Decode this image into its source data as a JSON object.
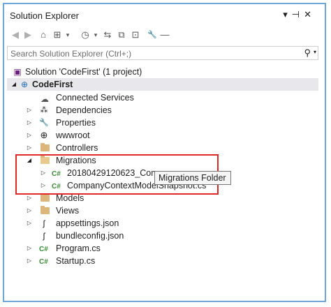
{
  "window": {
    "title": "Solution Explorer",
    "controls": [
      "▾",
      "⊣",
      "✕"
    ]
  },
  "toolbar": {
    "buttons": [
      "◀",
      "▶",
      "⌂",
      "⊞",
      "▾",
      "◷",
      "▾",
      "⇆",
      "⧉",
      "⊡",
      "🔧",
      "—"
    ]
  },
  "search": {
    "placeholder": "Search Solution Explorer (Ctrl+;)",
    "icon": "search-icon"
  },
  "tree": {
    "solution": "Solution 'CodeFirst' (1 project)",
    "project": "CodeFirst",
    "items": {
      "connected_services": "Connected Services",
      "dependencies": "Dependencies",
      "properties": "Properties",
      "wwwroot": "wwwroot",
      "controllers": "Controllers",
      "migrations": "Migrations",
      "migration_file": "20180429120623_Com",
      "snapshot_file": "CompanyContextModelSnapshot.cs",
      "models": "Models",
      "views": "Views",
      "appsettings": "appsettings.json",
      "bundleconfig": "bundleconfig.json",
      "program": "Program.cs",
      "startup": "Startup.cs"
    },
    "cs_badge": "C#"
  },
  "tooltip": {
    "text": "Migrations Folder"
  },
  "colors": {
    "highlight": "#e0282a",
    "frame": "#6ea6dc",
    "folder": "#dcb67a",
    "cs_green": "#388a34"
  }
}
